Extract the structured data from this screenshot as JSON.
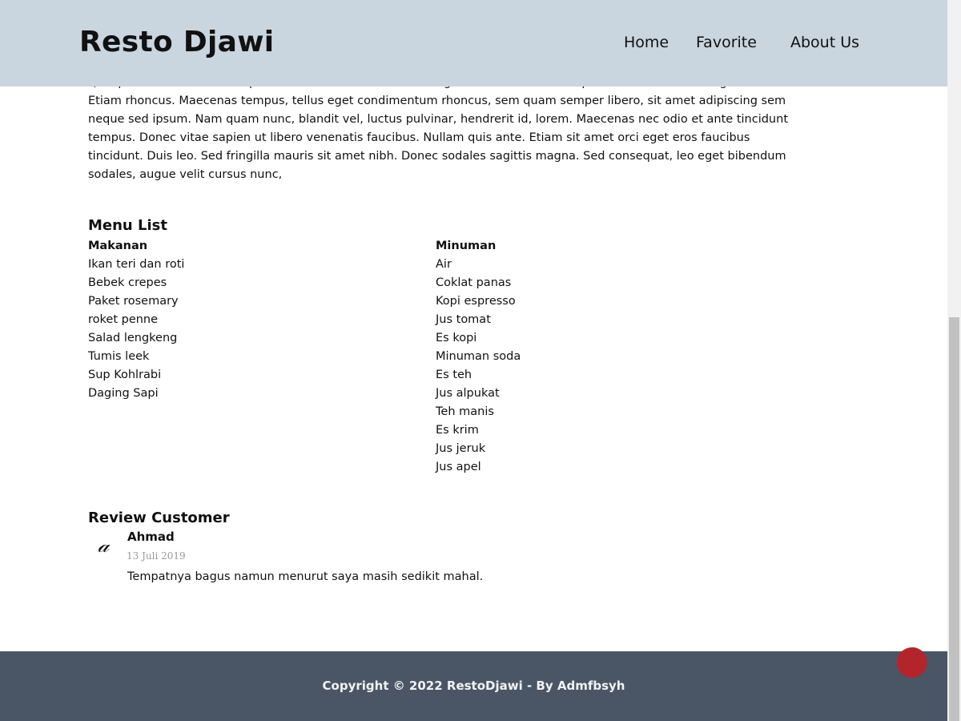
{
  "header": {
    "brand": "Resto Djawi",
    "nav": {
      "home": "Home",
      "favorite": "Favorite",
      "about": "About Us"
    }
  },
  "intro": {
    "text": "Quisque rutrum. Aenean imperdiet. Etiam ultricies nisi vel augue. Curabitur ullamcorper ultricies nisi. Nam eget dui. Etiam rhoncus. Maecenas tempus, tellus eget condimentum rhoncus, sem quam semper libero, sit amet adipiscing sem neque sed ipsum. Nam quam nunc, blandit vel, luctus pulvinar, hendrerit id, lorem. Maecenas nec odio et ante tincidunt tempus. Donec vitae sapien ut libero venenatis faucibus. Nullam quis ante. Etiam sit amet orci eget eros faucibus tincidunt. Duis leo. Sed fringilla mauris sit amet nibh. Donec sodales sagittis magna. Sed consequat, leo eget bibendum sodales, augue velit cursus nunc,"
  },
  "menu": {
    "title": "Menu List",
    "food": {
      "heading": "Makanan",
      "items": [
        "Ikan teri dan roti",
        "Bebek crepes",
        "Paket rosemary",
        "roket penne",
        "Salad lengkeng",
        "Tumis leek",
        "Sup Kohlrabi",
        "Daging Sapi"
      ]
    },
    "drinks": {
      "heading": "Minuman",
      "items": [
        "Air",
        "Coklat panas",
        "Kopi espresso",
        "Jus tomat",
        "Es kopi",
        "Minuman soda",
        "Es teh",
        "Jus alpukat",
        "Teh manis",
        "Es krim",
        "Jus jeruk",
        "Jus apel"
      ]
    }
  },
  "reviews": {
    "title": "Review Customer",
    "items": [
      {
        "icon": "user-icon",
        "name": "Ahmad",
        "date": "13 Juli 2019",
        "text": "Tempatnya bagus namun menurut saya masih sedikit mahal."
      }
    ]
  },
  "footer": {
    "copyright": "Copyright © 2022 RestoDjawi - By Admfbsyh"
  },
  "colors": {
    "header_bg": "#c9d5df",
    "footer_bg": "#4a5666",
    "fab": "#b3252b"
  }
}
